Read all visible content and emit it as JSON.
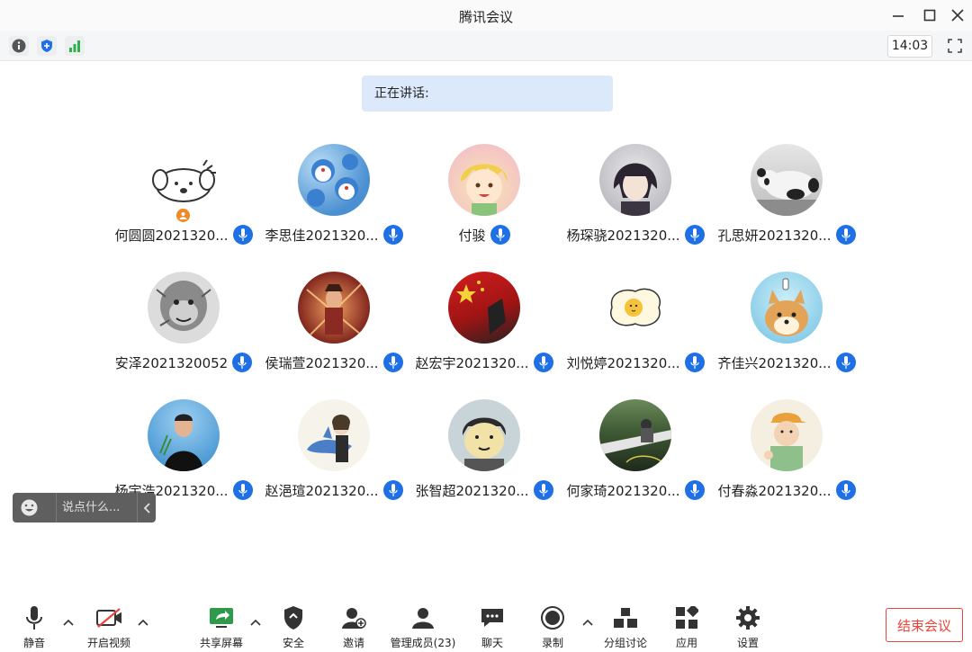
{
  "window": {
    "title": "腾讯会议"
  },
  "status": {
    "time": "14:03"
  },
  "speaking": {
    "label": "正在讲话:"
  },
  "participants": [
    {
      "name": "何圆圆2021320...",
      "host": true
    },
    {
      "name": "李思佳2021320..."
    },
    {
      "name": "付骏"
    },
    {
      "name": "杨琛骁2021320..."
    },
    {
      "name": "孔思妍2021320..."
    },
    {
      "name": "安泽2021320052"
    },
    {
      "name": "侯瑞萱2021320..."
    },
    {
      "name": "赵宏宇2021320..."
    },
    {
      "name": "刘悦婷2021320..."
    },
    {
      "name": "齐佳兴2021320..."
    },
    {
      "name": "杨宇浩2021320..."
    },
    {
      "name": "赵浥瑄2021320..."
    },
    {
      "name": "张智超2021320..."
    },
    {
      "name": "何家琦2021320..."
    },
    {
      "name": "付春淼2021320..."
    }
  ],
  "chat": {
    "placeholder": "说点什么..."
  },
  "toolbar": {
    "mute": "静音",
    "video": "开启视频",
    "share": "共享屏幕",
    "security": "安全",
    "invite": "邀请",
    "members": "管理成员(23)",
    "chat": "聊天",
    "record": "录制",
    "breakout": "分组讨论",
    "apps": "应用",
    "settings": "设置",
    "end": "结束会议"
  },
  "colors": {
    "accent": "#1f6fe5",
    "danger": "#e9453b",
    "speaking_bg": "#dce9fb",
    "host": "#f08a24"
  }
}
